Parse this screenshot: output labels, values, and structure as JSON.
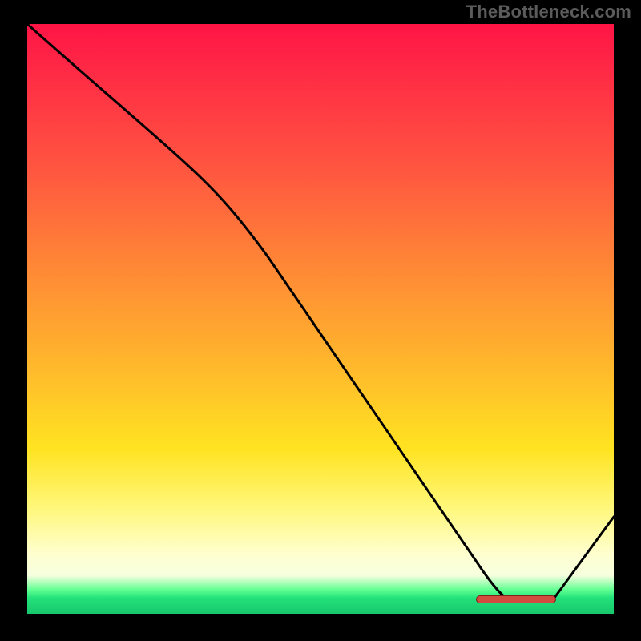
{
  "watermark": "TheBottleneck.com",
  "colors": {
    "top": "#ff1445",
    "mid": "#ffe321",
    "bottom": "#17c86c",
    "curve": "#000000",
    "marker": "#d34a3f"
  },
  "chart_data": {
    "type": "line",
    "title": "",
    "xlabel": "",
    "ylabel": "",
    "xlim": [
      0,
      100
    ],
    "ylim": [
      0,
      100
    ],
    "x": [
      0,
      10,
      20,
      27,
      35,
      45,
      55,
      65,
      75,
      82,
      86,
      90,
      100
    ],
    "values": [
      100,
      90,
      80,
      76,
      67,
      54,
      41,
      28,
      14,
      4,
      2,
      2,
      16
    ],
    "annotations": [
      {
        "type": "marker",
        "x_start": 78,
        "x_end": 91,
        "y": 2,
        "label": ""
      }
    ],
    "background": "vertical-gradient red→yellow→green"
  }
}
